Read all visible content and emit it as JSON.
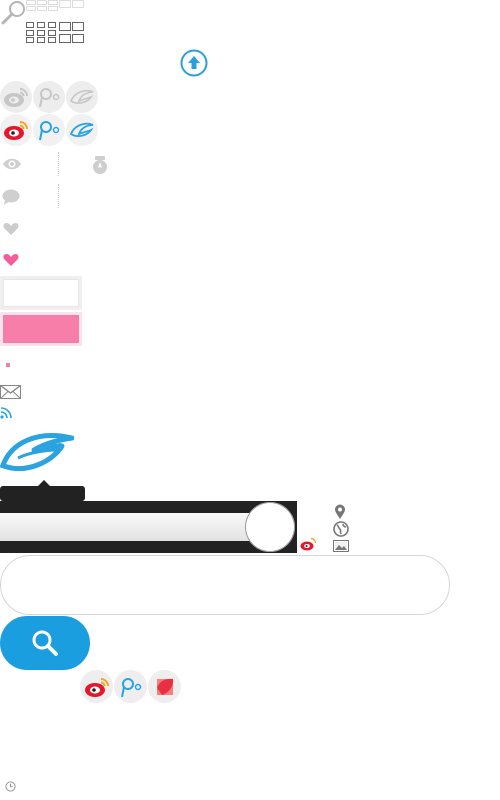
{
  "colors": {
    "weibo_red": "#e6162d",
    "weibo_orange": "#f5a623",
    "qq_blue": "#2aa3e0",
    "upload_blue": "#2b9fde",
    "pink": "#f77ea8",
    "heart_grey": "#cccccc",
    "dark_bar": "#222222",
    "search_blue": "#1a9ee0"
  },
  "icons": {
    "search_small": "magnifier-icon",
    "view_grid": "grid-view-icon",
    "upload": "upload-icon",
    "weibo": "weibo-icon",
    "tencent_weibo": "tencent-weibo-icon",
    "qq_zone": "qzone-icon",
    "eye": "eye-icon",
    "comment": "comment-icon",
    "heart": "heart-icon",
    "mail": "mail-icon",
    "rss": "rss-icon",
    "location": "location-pin-icon",
    "globe": "globe-icon",
    "image": "image-icon",
    "clock": "clock-icon",
    "badge": "medal-icon"
  },
  "search": {
    "placeholder": "",
    "value": ""
  },
  "slider": {
    "level": 0.9
  }
}
